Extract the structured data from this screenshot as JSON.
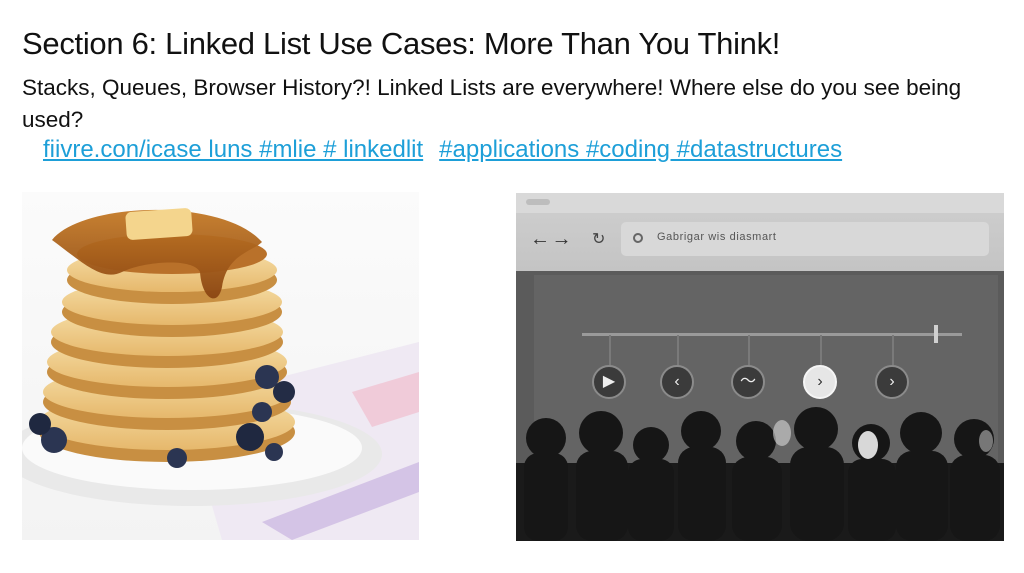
{
  "slide": {
    "title": "Section 6: Linked List Use Cases: More Than You Think!",
    "subtitle": "Stacks, Queues, Browser History?! Linked Lists are everywhere! Where else do you see being used?",
    "links": [
      "fiivre.con/icase luns #mlie # linkedlit",
      "#applications #coding #datastructures"
    ]
  },
  "browser": {
    "nav_arrows": "← →",
    "reload_icon": "↻",
    "url_text": "Gabrigar wis diasmart",
    "controls": [
      {
        "icon": "play-icon",
        "glyph": "▶"
      },
      {
        "icon": "back-icon",
        "glyph": "‹"
      },
      {
        "icon": "wave-icon",
        "glyph": "〜"
      },
      {
        "icon": "forward-icon",
        "glyph": "›"
      },
      {
        "icon": "next-icon",
        "glyph": "›"
      }
    ]
  },
  "colors": {
    "link": "#1d9fd8",
    "title": "#111111",
    "syrup": "#b5651d",
    "pancake": "#f1d49a",
    "blueberry": "#2b3552"
  }
}
